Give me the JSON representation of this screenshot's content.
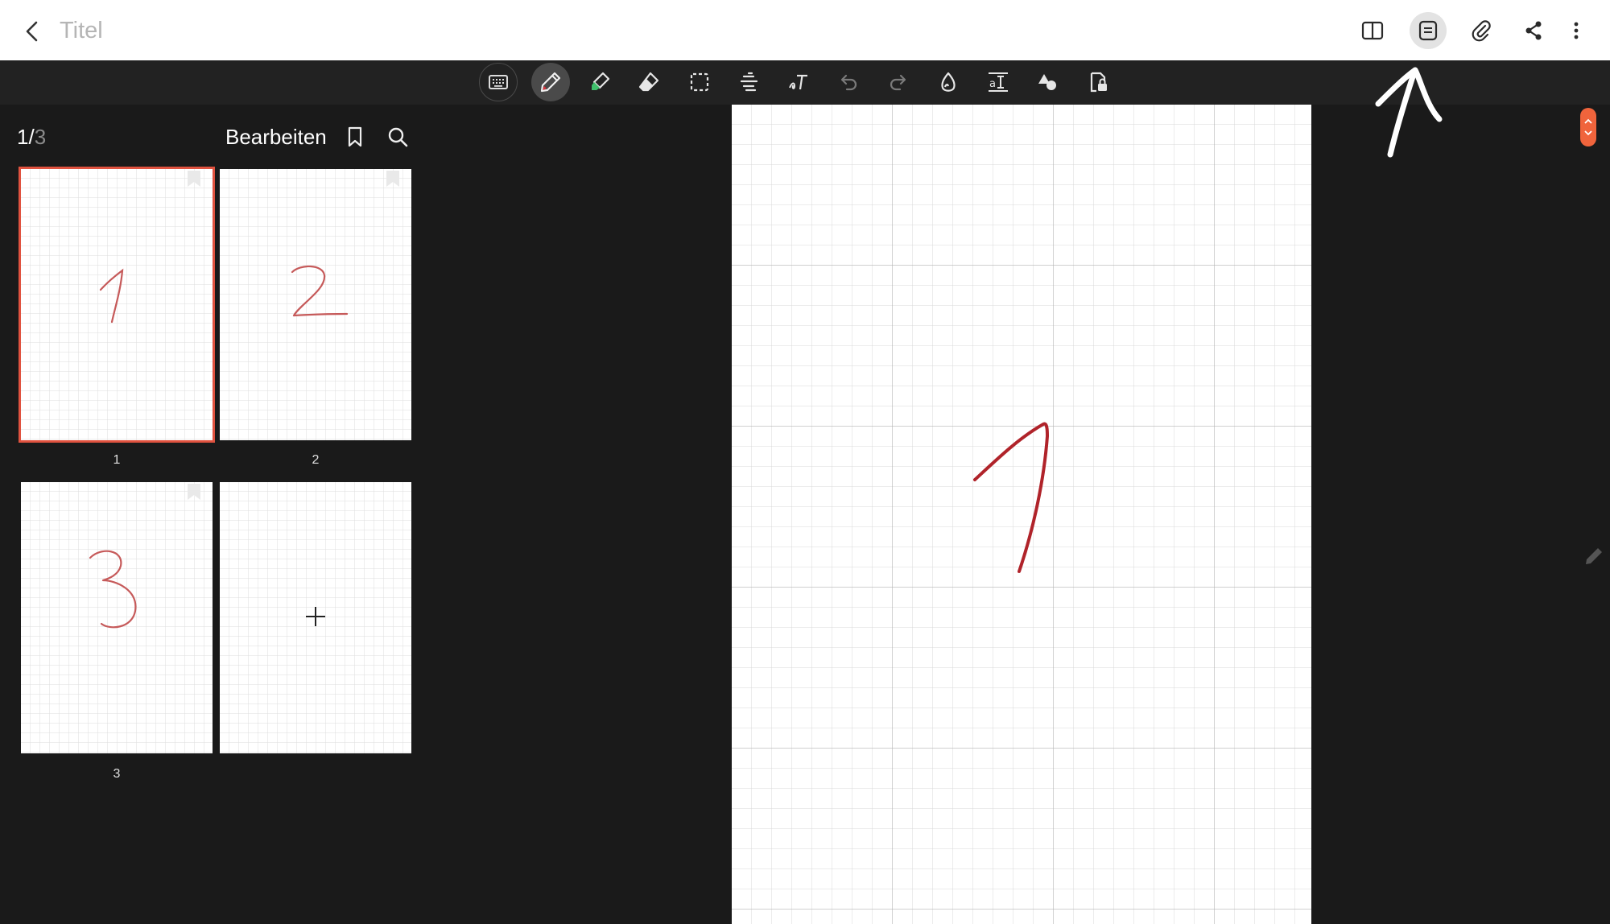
{
  "header": {
    "title": "Titel",
    "actions": [
      {
        "name": "reading-mode-icon"
      },
      {
        "name": "page-view-icon",
        "active": true
      },
      {
        "name": "attach-icon"
      },
      {
        "name": "share-icon"
      },
      {
        "name": "more-icon"
      }
    ]
  },
  "toolbar": {
    "tools": [
      {
        "name": "keyboard-icon"
      },
      {
        "name": "pen-icon",
        "selected": true
      },
      {
        "name": "highlighter-icon"
      },
      {
        "name": "eraser-icon"
      },
      {
        "name": "selection-icon"
      },
      {
        "name": "text-format-icon"
      },
      {
        "name": "handwriting-text-icon"
      },
      {
        "name": "undo-icon",
        "disabled": true
      },
      {
        "name": "redo-icon",
        "disabled": true
      },
      {
        "name": "shape-icon"
      },
      {
        "name": "text-spacing-icon"
      },
      {
        "name": "insert-shapes-icon"
      },
      {
        "name": "read-only-icon"
      }
    ]
  },
  "sidebar": {
    "current_page": "1/",
    "total_pages": "3",
    "edit_label": "Bearbeiten",
    "pages": [
      {
        "label": "1",
        "ink": "1",
        "current": true
      },
      {
        "label": "2",
        "ink": "2",
        "current": false
      },
      {
        "label": "3",
        "ink": "3",
        "current": false
      }
    ],
    "add_page_icon": "plus-icon"
  },
  "colors": {
    "ink": "#b0232a",
    "thumb_ink": "#c65a5a",
    "accent": "#f0643c",
    "selection_outline": "#e0523f"
  }
}
